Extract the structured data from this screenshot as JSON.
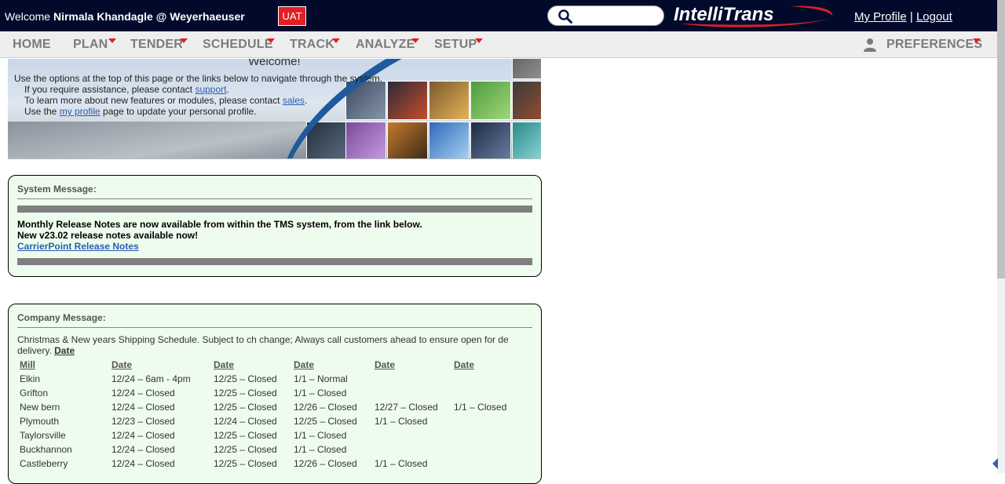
{
  "header": {
    "welcome_prefix": "Welcome",
    "user": "Nirmala Khandagle @ Weyerhaeuser",
    "env_badge": "UAT",
    "logo_text": "IntelliTrans",
    "my_profile": "My Profile",
    "separator": "|",
    "logout": "Logout"
  },
  "menu": {
    "items": [
      "HOME",
      "PLAN",
      "TENDER",
      "SCHEDULE",
      "TRACK",
      "ANALYZE",
      "SETUP"
    ],
    "preferences": "PREFERENCES"
  },
  "banner": {
    "title": "Welcome!",
    "line1": "Use the options at the top of this page or the links below to navigate through the system.",
    "line2_pre": "If you require assistance, please contact ",
    "line2_link": "support",
    "line2_post": ".",
    "line3_pre": "To learn more about new features or modules, please contact ",
    "line3_link": "sales",
    "line3_post": ".",
    "line4_pre": "Use the ",
    "line4_link": "my profile",
    "line4_post": " page to update your personal profile."
  },
  "system_message": {
    "title": "System Message:",
    "line1": "Monthly Release Notes are now available from within the TMS system, from the link below.",
    "line2": "New v23.02 release notes available now!",
    "link": "CarrierPoint Release Notes"
  },
  "company_message": {
    "title": "Company Message:",
    "text": "Christmas & New years Shipping Schedule. Subject to ch change; Always call customers ahead to ensure open for de delivery. ",
    "text_link": "Date",
    "columns": [
      "Mill",
      "Date",
      "Date",
      "Date",
      "Date",
      "Date"
    ],
    "rows": [
      [
        "Elkin",
        "12/24 – 6am - 4pm",
        "12/25 – Closed",
        "1/1 – Normal",
        "",
        ""
      ],
      [
        "Grifton",
        "12/24 – Closed",
        "12/25 – Closed",
        "1/1 – Closed",
        "",
        ""
      ],
      [
        "New bern",
        "12/24 – Closed",
        "12/25 – Closed",
        "12/26 – Closed",
        "12/27 – Closed",
        "1/1 – Closed"
      ],
      [
        "Plymouth",
        "12/23 – Closed",
        "12/24 – Closed",
        "12/25 – Closed",
        "1/1 – Closed",
        ""
      ],
      [
        "Taylorsville",
        "12/24 – Closed",
        "12/25 – Closed",
        "1/1 – Closed",
        "",
        ""
      ],
      [
        "Buckhannon",
        "12/24 – Closed",
        "12/25 – Closed",
        "1/1 – Closed",
        "",
        ""
      ],
      [
        "Castleberry",
        "12/24 – Closed",
        "12/25 – Closed",
        "12/26 – Closed",
        "1/1 – Closed",
        ""
      ]
    ]
  },
  "colors": {
    "topbar": "#010a2b",
    "accent_red": "#e31e24",
    "message_bg": "#eefcee",
    "link_blue": "#2a5db0"
  },
  "icons": [
    "search-icon",
    "user-icon",
    "caret-down-icon"
  ]
}
